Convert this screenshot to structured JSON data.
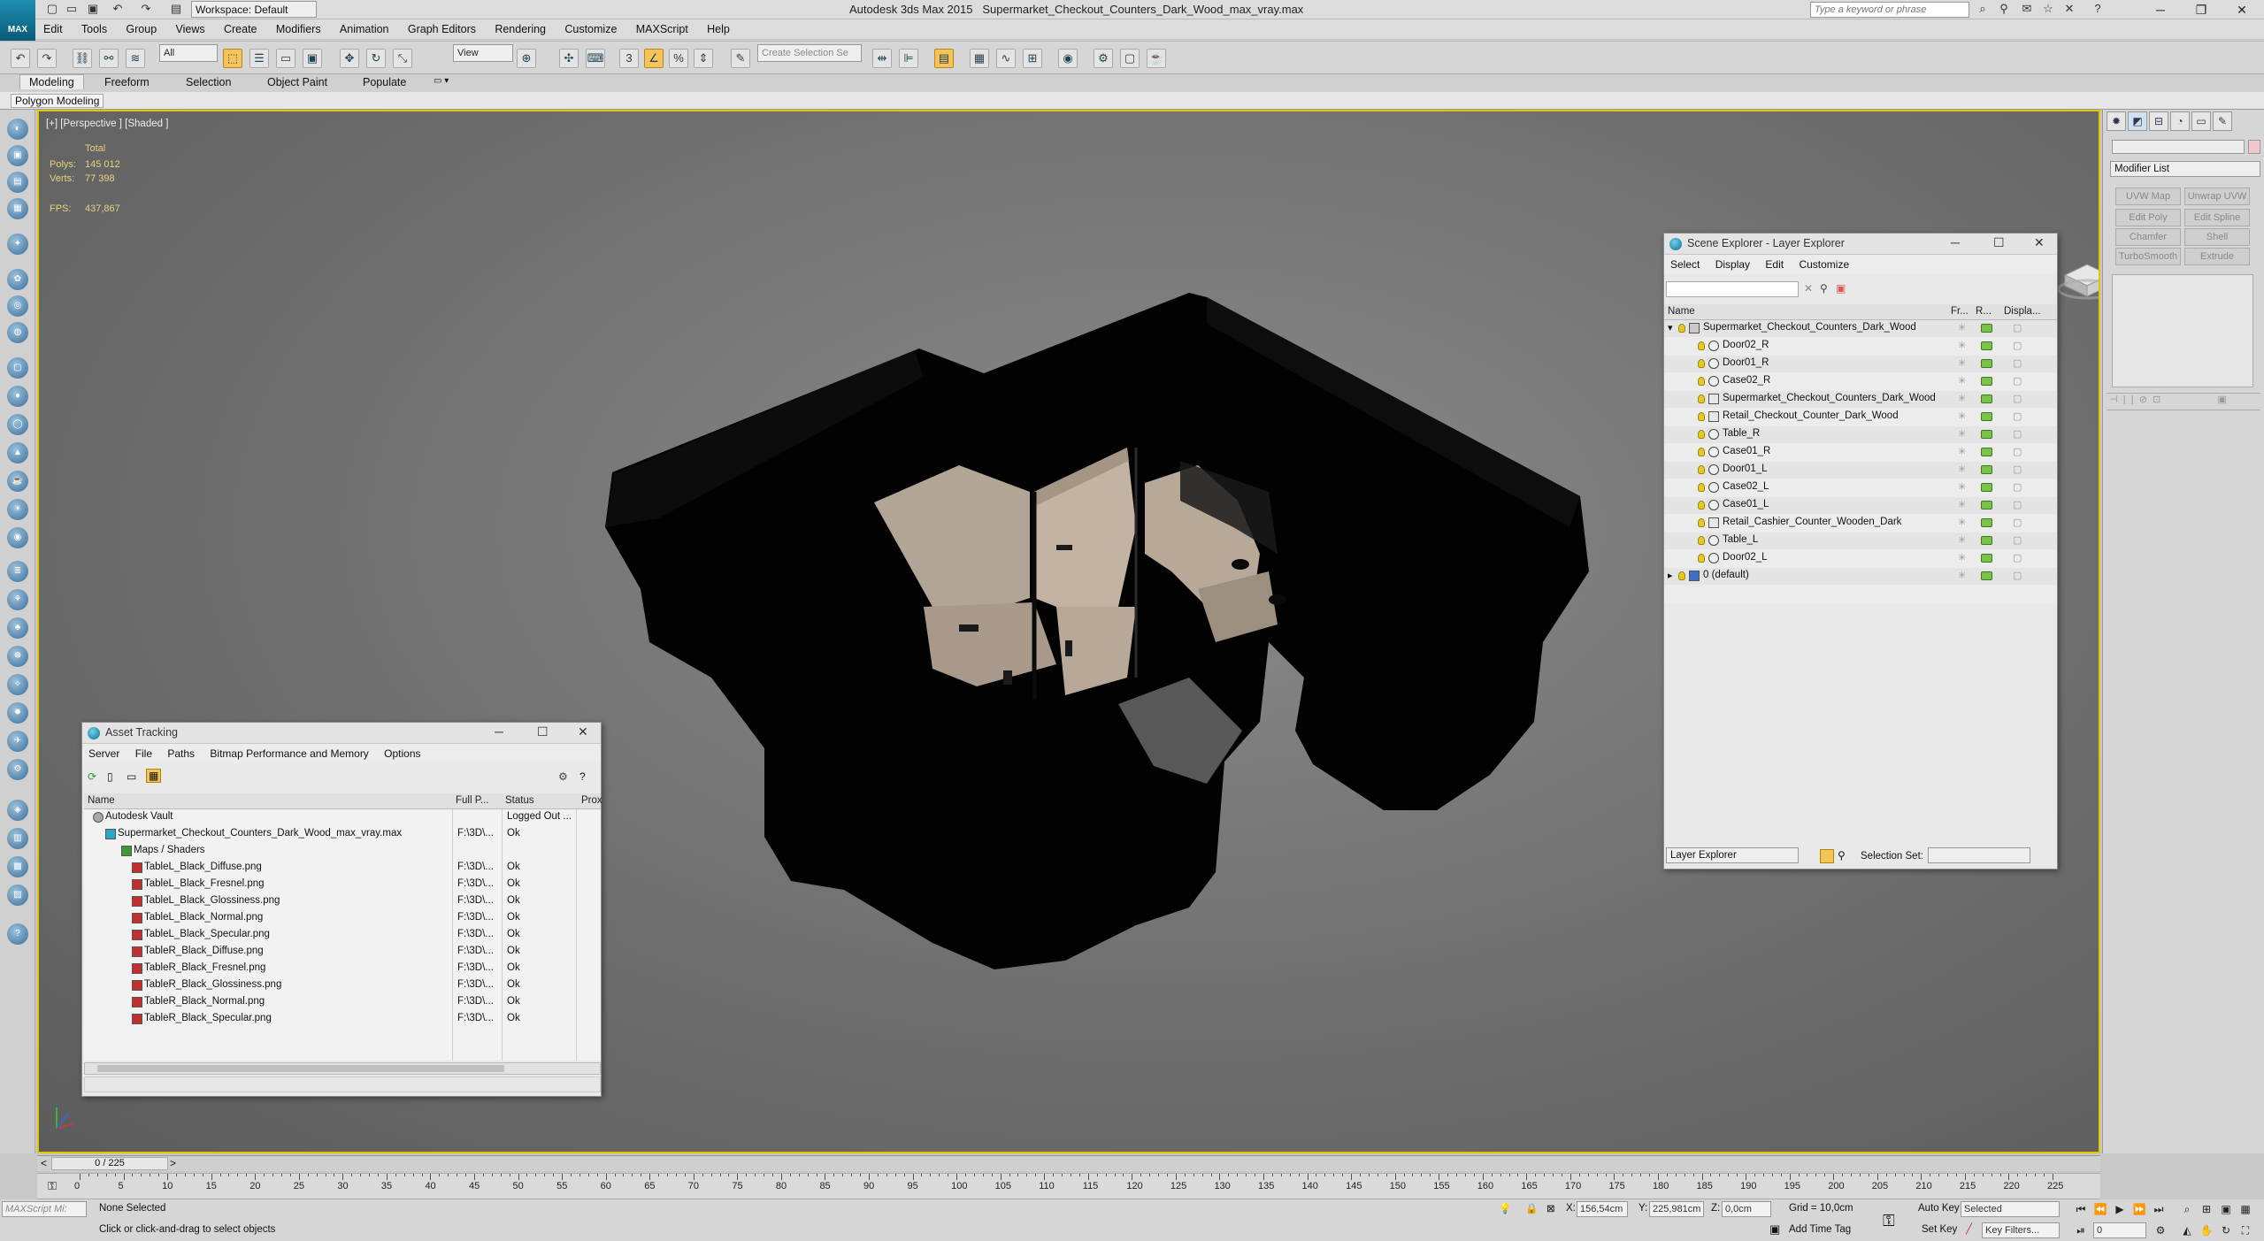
{
  "app": {
    "title": "Autodesk 3ds Max  2015",
    "filename": "Supermarket_Checkout_Counters_Dark_Wood_max_vray.max",
    "logo": "MAX"
  },
  "titlebar": {
    "workspace": "Workspace: Default",
    "search_placeholder": "Type a keyword or phrase"
  },
  "menu": [
    "Edit",
    "Tools",
    "Group",
    "Views",
    "Create",
    "Modifiers",
    "Animation",
    "Graph Editors",
    "Rendering",
    "Customize",
    "MAXScript",
    "Help"
  ],
  "toolbar": {
    "filter": "All",
    "refcoord": "View",
    "selset": "Create Selection Se"
  },
  "ribbon": {
    "tabs": [
      "Modeling",
      "Freeform",
      "Selection",
      "Object Paint",
      "Populate"
    ],
    "subtab": "Polygon Modeling"
  },
  "viewport": {
    "label": "[+] [Perspective ] [Shaded ]",
    "total": "Total",
    "polys_label": "Polys:",
    "polys": "145 012",
    "verts_label": "Verts:",
    "verts": "77 398",
    "fps_label": "FPS:",
    "fps": "437,867"
  },
  "modifier_panel": {
    "list": "Modifier List",
    "buttons": [
      "UVW Map",
      "Unwrap UVW",
      "Edit Poly",
      "Edit Spline",
      "Chamfer",
      "Shell",
      "TurboSmooth",
      "Extrude"
    ]
  },
  "scene_explorer": {
    "title": "Scene Explorer - Layer Explorer",
    "menu": [
      "Select",
      "Display",
      "Edit",
      "Customize"
    ],
    "columns": {
      "name": "Name",
      "frozen": "Fr...",
      "render": "R...",
      "display": "Displa..."
    },
    "rows": [
      {
        "name": "Supermarket_Checkout_Counters_Dark_Wood",
        "level": 0,
        "type": "layer"
      },
      {
        "name": "Door02_R",
        "level": 1,
        "type": "obj"
      },
      {
        "name": "Door01_R",
        "level": 1,
        "type": "obj"
      },
      {
        "name": "Case02_R",
        "level": 1,
        "type": "obj"
      },
      {
        "name": "Supermarket_Checkout_Counters_Dark_Wood",
        "level": 1,
        "type": "grp"
      },
      {
        "name": "Retail_Checkout_Counter_Dark_Wood",
        "level": 1,
        "type": "grp"
      },
      {
        "name": "Table_R",
        "level": 1,
        "type": "obj"
      },
      {
        "name": "Case01_R",
        "level": 1,
        "type": "obj"
      },
      {
        "name": "Door01_L",
        "level": 1,
        "type": "obj"
      },
      {
        "name": "Case02_L",
        "level": 1,
        "type": "obj"
      },
      {
        "name": "Case01_L",
        "level": 1,
        "type": "obj"
      },
      {
        "name": "Retail_Cashier_Counter_Wooden_Dark",
        "level": 1,
        "type": "grp"
      },
      {
        "name": "Table_L",
        "level": 1,
        "type": "obj"
      },
      {
        "name": "Door02_L",
        "level": 1,
        "type": "obj"
      },
      {
        "name": "0 (default)",
        "level": 0,
        "type": "default"
      }
    ],
    "footer": {
      "explorer": "Layer Explorer",
      "selset_label": "Selection Set:"
    }
  },
  "asset_tracking": {
    "title": "Asset Tracking",
    "menu": [
      "Server",
      "File",
      "Paths",
      "Bitmap Performance and Memory",
      "Options"
    ],
    "columns": {
      "name": "Name",
      "path": "Full P...",
      "status": "Status",
      "proxy": "Prox"
    },
    "rows": [
      {
        "name": "Autodesk Vault",
        "path": "",
        "status": "Logged Out ...",
        "level": 0
      },
      {
        "name": "Supermarket_Checkout_Counters_Dark_Wood_max_vray.max",
        "path": "F:\\3D\\...",
        "status": "Ok",
        "level": 1
      },
      {
        "name": "Maps / Shaders",
        "path": "",
        "status": "",
        "level": 2
      },
      {
        "name": "TableL_Black_Diffuse.png",
        "path": "F:\\3D\\...",
        "status": "Ok",
        "level": 3
      },
      {
        "name": "TableL_Black_Fresnel.png",
        "path": "F:\\3D\\...",
        "status": "Ok",
        "level": 3
      },
      {
        "name": "TableL_Black_Glossiness.png",
        "path": "F:\\3D\\...",
        "status": "Ok",
        "level": 3
      },
      {
        "name": "TableL_Black_Normal.png",
        "path": "F:\\3D\\...",
        "status": "Ok",
        "level": 3
      },
      {
        "name": "TableL_Black_Specular.png",
        "path": "F:\\3D\\...",
        "status": "Ok",
        "level": 3
      },
      {
        "name": "TableR_Black_Diffuse.png",
        "path": "F:\\3D\\...",
        "status": "Ok",
        "level": 3
      },
      {
        "name": "TableR_Black_Fresnel.png",
        "path": "F:\\3D\\...",
        "status": "Ok",
        "level": 3
      },
      {
        "name": "TableR_Black_Glossiness.png",
        "path": "F:\\3D\\...",
        "status": "Ok",
        "level": 3
      },
      {
        "name": "TableR_Black_Normal.png",
        "path": "F:\\3D\\...",
        "status": "Ok",
        "level": 3
      },
      {
        "name": "TableR_Black_Specular.png",
        "path": "F:\\3D\\...",
        "status": "Ok",
        "level": 3
      }
    ]
  },
  "timeline": {
    "frame": "0 / 225",
    "ticks": [
      "0",
      "5",
      "10",
      "15",
      "20",
      "25",
      "30",
      "35",
      "40",
      "45",
      "50",
      "55",
      "60",
      "65",
      "70",
      "75",
      "80",
      "85",
      "90",
      "95",
      "100",
      "105",
      "110",
      "115",
      "120",
      "125",
      "130",
      "135",
      "140",
      "145",
      "150",
      "155",
      "160",
      "165",
      "170",
      "175",
      "180",
      "185",
      "190",
      "195",
      "200",
      "205",
      "210",
      "215",
      "220",
      "225"
    ]
  },
  "status": {
    "selection": "None Selected",
    "prompt": "Click or click-and-drag to select objects",
    "listener": "MAXScript Mi:",
    "x_label": "X:",
    "x": "156,54cm",
    "y_label": "Y:",
    "y": "225,981cm",
    "z_label": "Z:",
    "z": "0,0cm",
    "grid": "Grid = 10,0cm",
    "autokey": "Auto Key",
    "selected": "Selected",
    "setkey": "Set Key",
    "keyfilters": "Key Filters...",
    "addtimetag": "Add Time Tag",
    "frame": "0"
  },
  "colors": {
    "viewport_border": "#e5c400",
    "accent": "#f5c35a",
    "status_ok": "#111111"
  }
}
